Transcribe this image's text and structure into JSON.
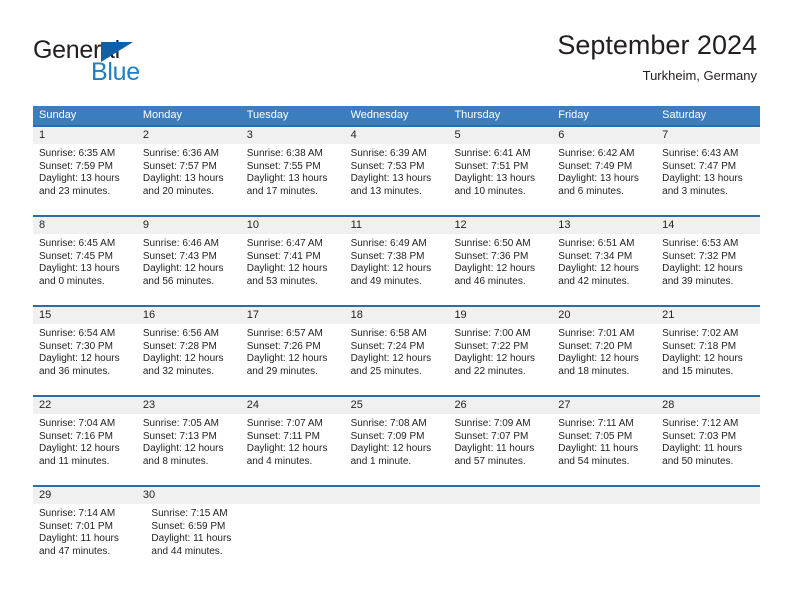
{
  "brand": {
    "word_general": "General",
    "word_blue": "Blue",
    "flag_icon": "blue-triangle-flag-icon"
  },
  "header": {
    "title": "September 2024",
    "location": "Turkheim, Germany"
  },
  "theme": {
    "header_blue": "#3a7ec0",
    "rule_blue": "#2c6ca8",
    "daynum_gray": "#f0f0f0",
    "brand_blue": "#1f7ec4",
    "text": "#231f20"
  },
  "weekdays": [
    "Sunday",
    "Monday",
    "Tuesday",
    "Wednesday",
    "Thursday",
    "Friday",
    "Saturday"
  ],
  "weeks": [
    {
      "days": [
        {
          "num": "1",
          "sunrise": "Sunrise: 6:35 AM",
          "sunset": "Sunset: 7:59 PM",
          "daylight1": "Daylight: 13 hours",
          "daylight2": "and 23 minutes."
        },
        {
          "num": "2",
          "sunrise": "Sunrise: 6:36 AM",
          "sunset": "Sunset: 7:57 PM",
          "daylight1": "Daylight: 13 hours",
          "daylight2": "and 20 minutes."
        },
        {
          "num": "3",
          "sunrise": "Sunrise: 6:38 AM",
          "sunset": "Sunset: 7:55 PM",
          "daylight1": "Daylight: 13 hours",
          "daylight2": "and 17 minutes."
        },
        {
          "num": "4",
          "sunrise": "Sunrise: 6:39 AM",
          "sunset": "Sunset: 7:53 PM",
          "daylight1": "Daylight: 13 hours",
          "daylight2": "and 13 minutes."
        },
        {
          "num": "5",
          "sunrise": "Sunrise: 6:41 AM",
          "sunset": "Sunset: 7:51 PM",
          "daylight1": "Daylight: 13 hours",
          "daylight2": "and 10 minutes."
        },
        {
          "num": "6",
          "sunrise": "Sunrise: 6:42 AM",
          "sunset": "Sunset: 7:49 PM",
          "daylight1": "Daylight: 13 hours",
          "daylight2": "and 6 minutes."
        },
        {
          "num": "7",
          "sunrise": "Sunrise: 6:43 AM",
          "sunset": "Sunset: 7:47 PM",
          "daylight1": "Daylight: 13 hours",
          "daylight2": "and 3 minutes."
        }
      ]
    },
    {
      "days": [
        {
          "num": "8",
          "sunrise": "Sunrise: 6:45 AM",
          "sunset": "Sunset: 7:45 PM",
          "daylight1": "Daylight: 13 hours",
          "daylight2": "and 0 minutes."
        },
        {
          "num": "9",
          "sunrise": "Sunrise: 6:46 AM",
          "sunset": "Sunset: 7:43 PM",
          "daylight1": "Daylight: 12 hours",
          "daylight2": "and 56 minutes."
        },
        {
          "num": "10",
          "sunrise": "Sunrise: 6:47 AM",
          "sunset": "Sunset: 7:41 PM",
          "daylight1": "Daylight: 12 hours",
          "daylight2": "and 53 minutes."
        },
        {
          "num": "11",
          "sunrise": "Sunrise: 6:49 AM",
          "sunset": "Sunset: 7:38 PM",
          "daylight1": "Daylight: 12 hours",
          "daylight2": "and 49 minutes."
        },
        {
          "num": "12",
          "sunrise": "Sunrise: 6:50 AM",
          "sunset": "Sunset: 7:36 PM",
          "daylight1": "Daylight: 12 hours",
          "daylight2": "and 46 minutes."
        },
        {
          "num": "13",
          "sunrise": "Sunrise: 6:51 AM",
          "sunset": "Sunset: 7:34 PM",
          "daylight1": "Daylight: 12 hours",
          "daylight2": "and 42 minutes."
        },
        {
          "num": "14",
          "sunrise": "Sunrise: 6:53 AM",
          "sunset": "Sunset: 7:32 PM",
          "daylight1": "Daylight: 12 hours",
          "daylight2": "and 39 minutes."
        }
      ]
    },
    {
      "days": [
        {
          "num": "15",
          "sunrise": "Sunrise: 6:54 AM",
          "sunset": "Sunset: 7:30 PM",
          "daylight1": "Daylight: 12 hours",
          "daylight2": "and 36 minutes."
        },
        {
          "num": "16",
          "sunrise": "Sunrise: 6:56 AM",
          "sunset": "Sunset: 7:28 PM",
          "daylight1": "Daylight: 12 hours",
          "daylight2": "and 32 minutes."
        },
        {
          "num": "17",
          "sunrise": "Sunrise: 6:57 AM",
          "sunset": "Sunset: 7:26 PM",
          "daylight1": "Daylight: 12 hours",
          "daylight2": "and 29 minutes."
        },
        {
          "num": "18",
          "sunrise": "Sunrise: 6:58 AM",
          "sunset": "Sunset: 7:24 PM",
          "daylight1": "Daylight: 12 hours",
          "daylight2": "and 25 minutes."
        },
        {
          "num": "19",
          "sunrise": "Sunrise: 7:00 AM",
          "sunset": "Sunset: 7:22 PM",
          "daylight1": "Daylight: 12 hours",
          "daylight2": "and 22 minutes."
        },
        {
          "num": "20",
          "sunrise": "Sunrise: 7:01 AM",
          "sunset": "Sunset: 7:20 PM",
          "daylight1": "Daylight: 12 hours",
          "daylight2": "and 18 minutes."
        },
        {
          "num": "21",
          "sunrise": "Sunrise: 7:02 AM",
          "sunset": "Sunset: 7:18 PM",
          "daylight1": "Daylight: 12 hours",
          "daylight2": "and 15 minutes."
        }
      ]
    },
    {
      "days": [
        {
          "num": "22",
          "sunrise": "Sunrise: 7:04 AM",
          "sunset": "Sunset: 7:16 PM",
          "daylight1": "Daylight: 12 hours",
          "daylight2": "and 11 minutes."
        },
        {
          "num": "23",
          "sunrise": "Sunrise: 7:05 AM",
          "sunset": "Sunset: 7:13 PM",
          "daylight1": "Daylight: 12 hours",
          "daylight2": "and 8 minutes."
        },
        {
          "num": "24",
          "sunrise": "Sunrise: 7:07 AM",
          "sunset": "Sunset: 7:11 PM",
          "daylight1": "Daylight: 12 hours",
          "daylight2": "and 4 minutes."
        },
        {
          "num": "25",
          "sunrise": "Sunrise: 7:08 AM",
          "sunset": "Sunset: 7:09 PM",
          "daylight1": "Daylight: 12 hours",
          "daylight2": "and 1 minute."
        },
        {
          "num": "26",
          "sunrise": "Sunrise: 7:09 AM",
          "sunset": "Sunset: 7:07 PM",
          "daylight1": "Daylight: 11 hours",
          "daylight2": "and 57 minutes."
        },
        {
          "num": "27",
          "sunrise": "Sunrise: 7:11 AM",
          "sunset": "Sunset: 7:05 PM",
          "daylight1": "Daylight: 11 hours",
          "daylight2": "and 54 minutes."
        },
        {
          "num": "28",
          "sunrise": "Sunrise: 7:12 AM",
          "sunset": "Sunset: 7:03 PM",
          "daylight1": "Daylight: 11 hours",
          "daylight2": "and 50 minutes."
        }
      ]
    },
    {
      "days": [
        {
          "num": "29",
          "sunrise": "Sunrise: 7:14 AM",
          "sunset": "Sunset: 7:01 PM",
          "daylight1": "Daylight: 11 hours",
          "daylight2": "and 47 minutes."
        },
        {
          "num": "30",
          "sunrise": "Sunrise: 7:15 AM",
          "sunset": "Sunset: 6:59 PM",
          "daylight1": "Daylight: 11 hours",
          "daylight2": "and 44 minutes."
        }
      ]
    }
  ]
}
